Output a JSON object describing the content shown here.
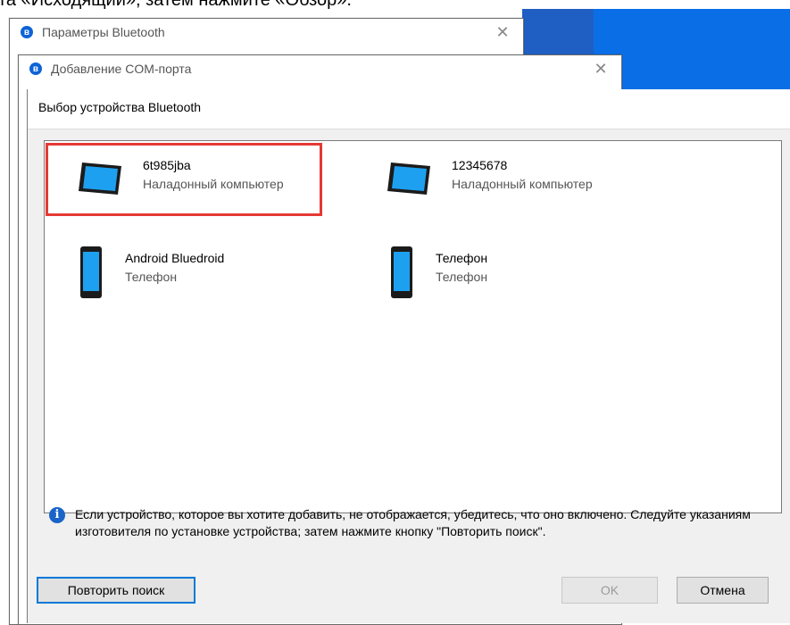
{
  "instruction": {
    "text": "та «Исходящий», затем нажмите «Обзор»."
  },
  "windows": {
    "bluetooth_params": {
      "title": "Параметры Bluetooth"
    },
    "add_com_port": {
      "title": "Добавление COM-порта"
    }
  },
  "dialog": {
    "title": "Выбор устройства Bluetooth",
    "devices": [
      {
        "name": "6t985jba",
        "type": "Наладонный компьютер",
        "icon": "tablet-icon",
        "selected": true
      },
      {
        "name": "12345678",
        "type": "Наладонный компьютер",
        "icon": "tablet-icon",
        "selected": false
      },
      {
        "name": "Android Bluedroid",
        "type": "Телефон",
        "icon": "phone-icon",
        "selected": false
      },
      {
        "name": "Телефон",
        "type": "Телефон",
        "icon": "phone-icon",
        "selected": false
      }
    ],
    "info": "Если устройство, которое вы хотите добавить, не отображается, убедитесь, что оно включено. Следуйте указаниям изготовителя по установке устройства; затем нажмите кнопку \"Повторить поиск\".",
    "buttons": {
      "retry": "Повторить поиск",
      "ok": "OK",
      "cancel": "Отмена"
    }
  },
  "colors": {
    "accent": "#0078d7",
    "highlight": "#e53935",
    "desktop": "#1f5fc3"
  }
}
